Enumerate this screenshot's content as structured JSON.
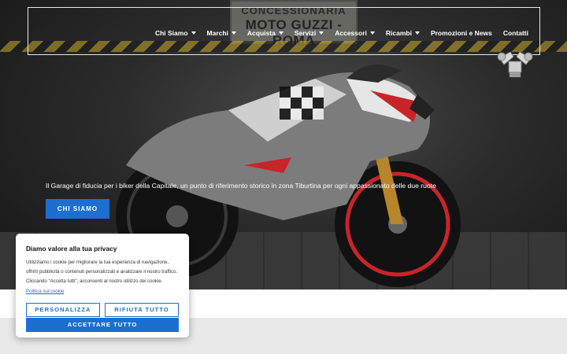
{
  "nav": {
    "items": [
      {
        "label": "Chi Siamo",
        "dropdown": true
      },
      {
        "label": "Marchi",
        "dropdown": true
      },
      {
        "label": "Acquista",
        "dropdown": true
      },
      {
        "label": "Servizi",
        "dropdown": true
      },
      {
        "label": "Accessori",
        "dropdown": true
      },
      {
        "label": "Ricambi",
        "dropdown": true
      },
      {
        "label": "Promozioni e News",
        "dropdown": false
      },
      {
        "label": "Contatti",
        "dropdown": false
      }
    ]
  },
  "hero": {
    "sign_line1": "CONCESSIONARIA",
    "sign_line2": "MOTO GUZZI - ROMA",
    "tagline": "Il Garage di fiducia per i biker della Capitale, un punto di riferimento storico in zona Tiburtina per ogni appassionato delle due ruote",
    "cta_label": "CHI SIAMO"
  },
  "cookie": {
    "title": "Diamo valore alla tua privacy",
    "body": "Utilizziamo i cookie per migliorare la tua esperienza di navigazione, offrirti pubblicità o contenuti personalizzati e analizzare il nostro traffico. Cliccando \"Accetta tutti\", acconsenti al nostro utilizzo dei cookie.",
    "link_label": "Politica sui cookie",
    "customize_label": "PERSONALIZZA",
    "reject_label": "RIFIUTA TUTTO",
    "accept_label": "ACCETTARE TUTTO"
  },
  "colors": {
    "accent": "#1b6fd1",
    "bike_red": "#c8242a"
  }
}
